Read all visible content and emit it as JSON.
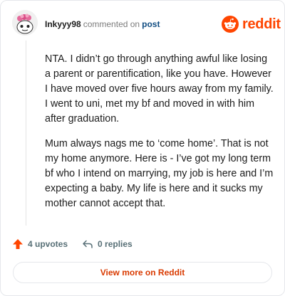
{
  "comment": {
    "username": "Inkyyy98",
    "commented_text": "commented on",
    "post_link": "post",
    "body": [
      "NTA. I didn’t go through anything awful like losing a parent or parentification, like you have. However I have moved over five hours away from my family. I went to uni, met my bf and moved in with him after graduation.",
      "Mum always nags me to ‘come home’. That is not my home anymore. Here is - I’ve got my long term bf who I intend on marrying, my job is here and I’m expecting a baby. My life is here and it sucks my mother cannot accept that."
    ]
  },
  "brand": {
    "name": "reddit",
    "color": "#ff4500",
    "icon": "reddit-snoo-icon"
  },
  "actions": {
    "upvotes_label": "4 upvotes",
    "upvote_icon": "upvote-arrow-icon",
    "replies_label": "0 replies",
    "reply_icon": "reply-arrow-icon"
  },
  "footer": {
    "view_more_label": "View more on Reddit"
  },
  "colors": {
    "accent": "#ff4500",
    "link": "#0f4c81",
    "muted": "#576f76"
  }
}
